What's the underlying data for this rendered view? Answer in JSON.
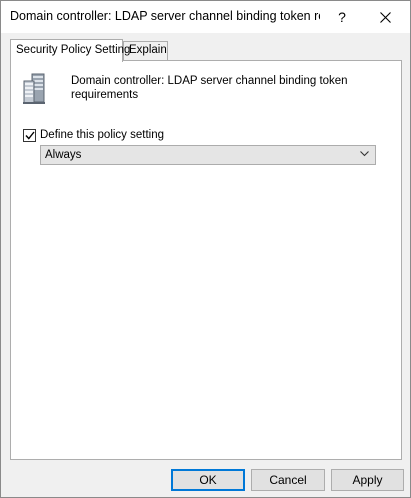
{
  "window": {
    "title": "Domain controller: LDAP server channel binding token re...",
    "help_glyph": "?"
  },
  "tabs": [
    {
      "label": "Security Policy Setting",
      "active": true
    },
    {
      "label": "Explain",
      "active": false
    }
  ],
  "policy": {
    "icon": "server-icon",
    "title": "Domain controller: LDAP server channel binding token requirements",
    "define_checkbox_label": "Define this policy setting",
    "define_checked": true,
    "dropdown_value": "Always"
  },
  "buttons": {
    "ok": "OK",
    "cancel": "Cancel",
    "apply": "Apply"
  },
  "colors": {
    "accent": "#0078d7",
    "panel_bg": "#ffffff",
    "window_bg": "#f0f0f0"
  }
}
